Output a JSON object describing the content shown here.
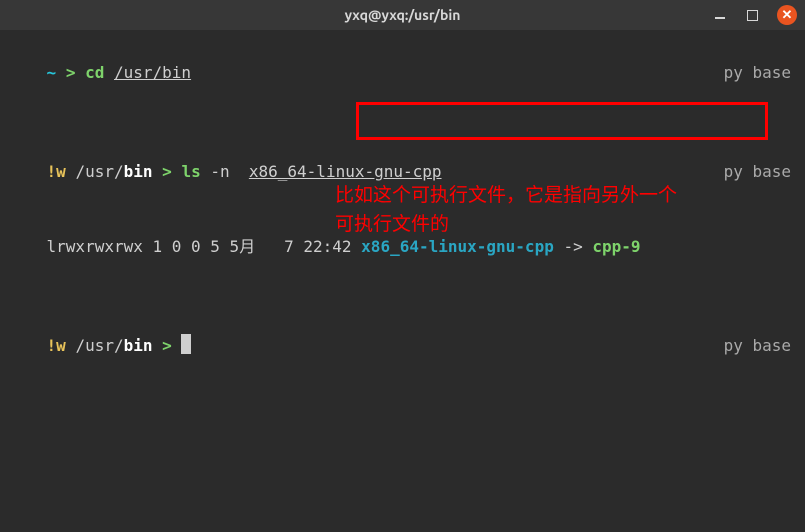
{
  "titlebar": {
    "title": "yxq@yxq:/usr/bin"
  },
  "env_label": "py base",
  "line1": {
    "home": "~",
    "chev": ">",
    "cmd": "cd",
    "path": "/usr/bin"
  },
  "line2": {
    "w": "!w",
    "dir": "/usr/",
    "dirbold": "bin",
    "chev": ">",
    "cmd": "ls",
    "flag": "-n",
    "arg": "x86_64-linux-gnu-cpp"
  },
  "line3": {
    "perms": "lrwxrwxrwx 1 0 0 5 5月   7 22:42",
    "link": "x86_64-linux-gnu-cpp",
    "arrow": "->",
    "target": "cpp-9"
  },
  "line4": {
    "w": "!w",
    "dir": "/usr/",
    "dirbold": "bin",
    "chev": ">"
  },
  "annotation": {
    "l1": "比如这个可执行文件，它是指向另外一个",
    "l2": "可执行文件的"
  }
}
